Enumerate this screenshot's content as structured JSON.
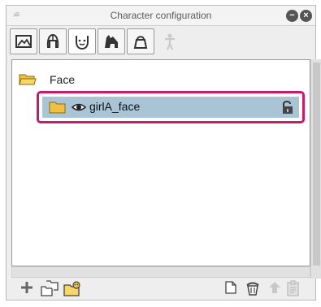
{
  "window": {
    "title": "Character configuration",
    "grip_glyph": "›≡",
    "minimize_glyph": "−",
    "close_glyph": "×"
  },
  "tabs": [
    {
      "name": "picture-icon",
      "active": false
    },
    {
      "name": "hair-icon",
      "active": false
    },
    {
      "name": "face-icon",
      "active": true
    },
    {
      "name": "animal-icon",
      "active": false
    },
    {
      "name": "bag-icon",
      "active": false
    },
    {
      "name": "figure-icon",
      "active": false,
      "disabled": true
    }
  ],
  "tree": {
    "root": {
      "label": "Face",
      "icon": "folder-open-icon"
    },
    "child": {
      "label": "girlA_face",
      "icon": "folder-icon",
      "visibility_icon": "eye-icon",
      "lock_icon": "lock-icon",
      "selected": true
    }
  },
  "bottom_toolbar": {
    "left": [
      "add-icon",
      "new-folders-icon",
      "folder-person-icon"
    ],
    "right": [
      "new-page-icon",
      "delete-icon",
      "upload-icon",
      "paste-icon"
    ]
  },
  "colors": {
    "selection": "#a9c5d5",
    "highlight_border": "#c8196b",
    "folder": "#f0c040"
  }
}
